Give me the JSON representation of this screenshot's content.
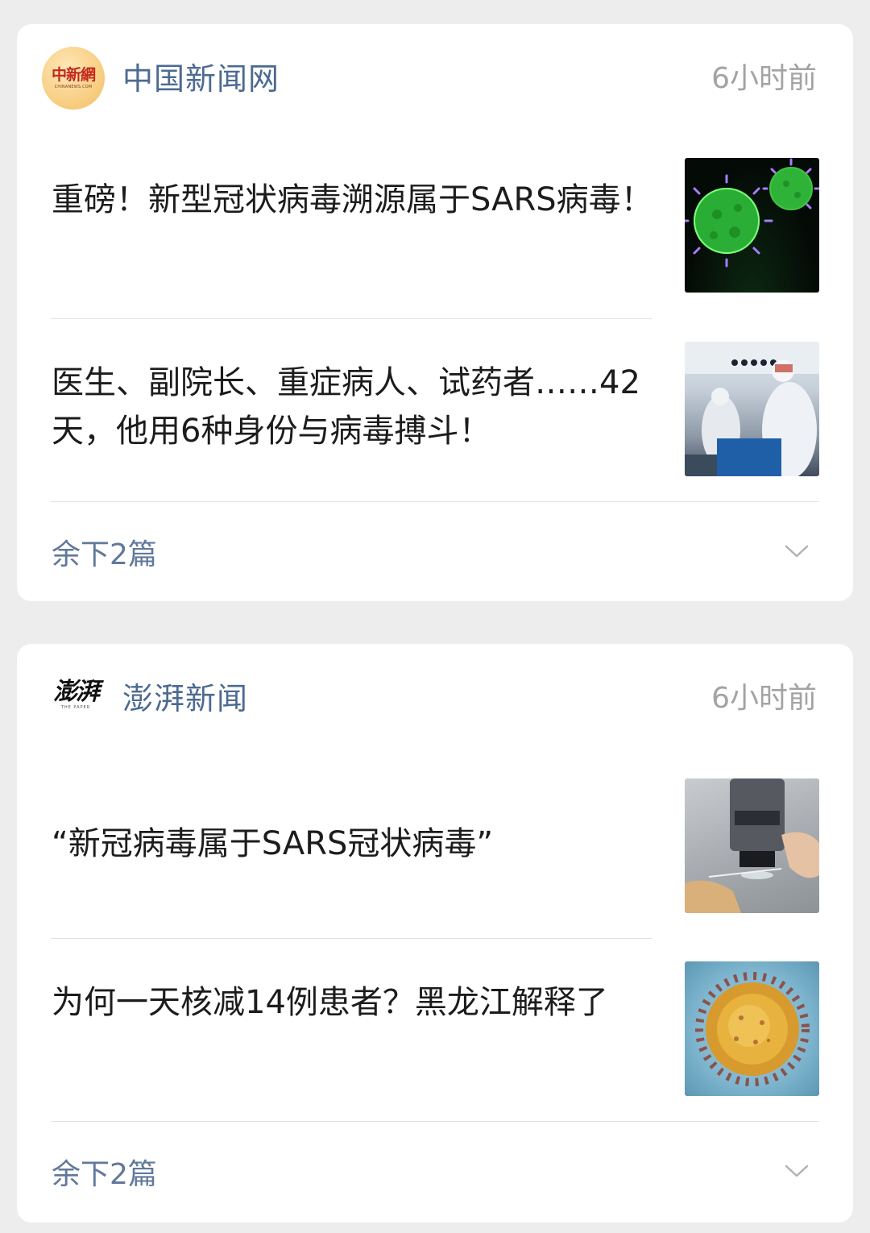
{
  "cards": [
    {
      "source": {
        "logo_cn": "中新網",
        "logo_en": "CHINANEWS.COM",
        "name": "中国新闻网",
        "time": "6小时前"
      },
      "articles": [
        {
          "title": "重磅！新型冠状病毒溯源属于SARS病毒！",
          "thumb_icon": "green-virus-image"
        },
        {
          "title": "医生、副院长、重症病人、试药者……42天，他用6种身份与病毒搏斗！",
          "thumb_icon": "medical-staff-image"
        }
      ],
      "more_label": "余下2篇"
    },
    {
      "source": {
        "logo_cn": "澎湃",
        "logo_en": "THE PAPER",
        "name": "澎湃新闻",
        "time": "6小时前"
      },
      "articles": [
        {
          "title": "“新冠病毒属于SARS冠状病毒”",
          "thumb_icon": "microscope-image"
        },
        {
          "title": "为何一天核减14例患者？黑龙江解释了",
          "thumb_icon": "gold-virus-image"
        }
      ],
      "more_label": "余下2篇"
    }
  ],
  "colors": {
    "background": "#ededed",
    "card": "#ffffff",
    "source_name": "#4d6a91",
    "time": "#a3a3a3",
    "title": "#1c1c1c",
    "more": "#61799a"
  }
}
